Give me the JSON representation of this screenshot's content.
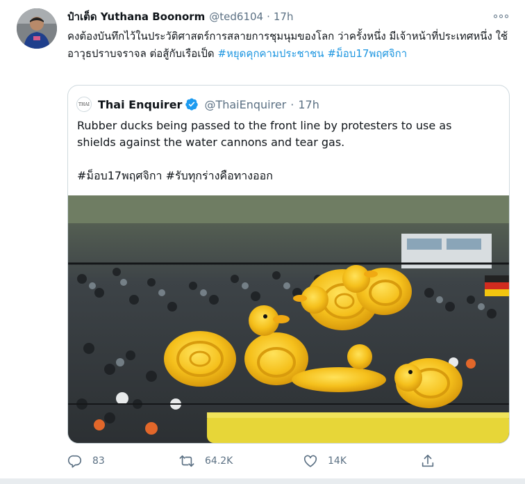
{
  "tweet": {
    "author_name": "ป๋าเต็ด Yuthana Boonorm",
    "handle": "@ted6104",
    "separator": "·",
    "time": "17h",
    "text_plain": "คงต้องบันทึกไว้ในประวัติศาสตร์การสลายการชุมนุมของโลก ว่าครั้งหนึ่ง มีเจ้าหน้าที่ประเทศหนึ่ง ใช้อาวุธปราบจราจล ต่อสู้กับเรือเป็ด",
    "hashtag_1": "#หยุดคุกคามประชาชน",
    "hashtag_2": "#ม็อบ17พฤศจิกา"
  },
  "quote": {
    "logo_text": "THAI",
    "name": "Thai Enquirer",
    "handle": "@ThaiEnquirer",
    "separator": "·",
    "time": "17h",
    "text": "Rubber ducks being passed to the front line by protesters to use as shields against the water cannons and tear gas.",
    "tags": "#ม็อบ17พฤศจิกา #รับทุกร่างคือทางออก"
  },
  "actions": {
    "reply_count": "83",
    "retweet_count": "64.2K",
    "like_count": "14K"
  },
  "colors": {
    "link": "#1b95e0",
    "secondary_text": "#5b7083",
    "border": "#cfd9de",
    "duck_yellow": "#f6c21c"
  },
  "icons": [
    "more-icon",
    "verified-icon",
    "reply-icon",
    "retweet-icon",
    "like-icon",
    "share-icon"
  ]
}
